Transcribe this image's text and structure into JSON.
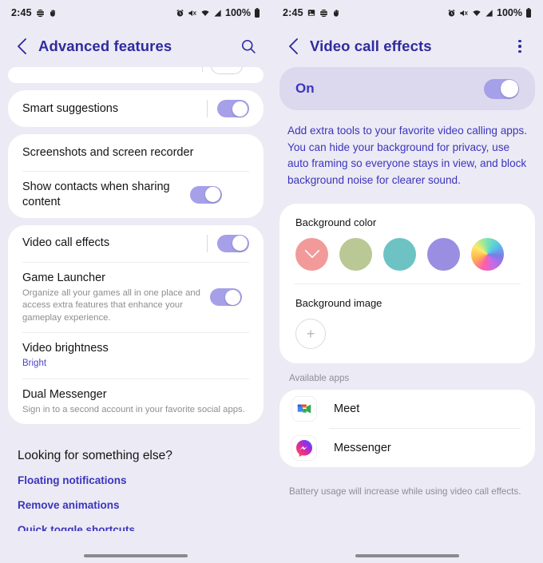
{
  "left": {
    "status": {
      "time": "2:45",
      "left_icons": [
        "globe-icon",
        "hand-icon"
      ],
      "right_icons": [
        "alarm-icon",
        "mute-icon",
        "wifi-icon",
        "signal-icon"
      ],
      "battery_text": "100%",
      "battery_icon": "battery-full-icon"
    },
    "appbar": {
      "title": "Advanced features",
      "back_icon": "back-chevron-icon",
      "search_icon": "search-icon"
    },
    "items": [
      {
        "title": "Smart suggestions",
        "toggle": true,
        "divider_before_toggle": true
      },
      {
        "title": "Screenshots and screen recorder"
      },
      {
        "title": "Show contacts when sharing content",
        "toggle": true
      },
      {
        "title": "Video call effects",
        "toggle": true,
        "divider_before_toggle": true
      },
      {
        "title": "Game Launcher",
        "sub": "Organize all your games all in one place and access extra features that enhance your gameplay experience.",
        "toggle": true
      },
      {
        "title": "Video brightness",
        "sub": "Bright",
        "sub_accent": true
      },
      {
        "title": "Dual Messenger",
        "sub": "Sign in to a second account in your favorite social apps."
      }
    ],
    "footer": {
      "title": "Looking for something else?",
      "links": [
        "Floating notifications",
        "Remove animations",
        "Quick toggle shortcuts"
      ]
    }
  },
  "right": {
    "status": {
      "time": "2:45",
      "left_icons": [
        "image-icon",
        "globe-icon",
        "hand-icon"
      ],
      "right_icons": [
        "alarm-icon",
        "mute-icon",
        "wifi-icon",
        "signal-icon"
      ],
      "battery_text": "100%",
      "battery_icon": "battery-full-icon"
    },
    "appbar": {
      "title": "Video call effects",
      "back_icon": "back-chevron-icon",
      "more_icon": "more-options-icon"
    },
    "master_switch": {
      "label": "On",
      "enabled": true
    },
    "description": "Add extra tools to your favorite video calling apps. You can hide your background for privacy, use auto framing so everyone stays in view, and block background noise for clearer sound.",
    "background_color": {
      "label": "Background color",
      "swatches": [
        {
          "name": "coral",
          "hex": "#f29a9a",
          "selected": true
        },
        {
          "name": "sage",
          "hex": "#b9c894",
          "selected": false
        },
        {
          "name": "teal",
          "hex": "#6dc3c4",
          "selected": false
        },
        {
          "name": "violet",
          "hex": "#9a8ee2",
          "selected": false
        },
        {
          "name": "rainbow",
          "hex": "rainbow",
          "selected": false
        }
      ]
    },
    "background_image": {
      "label": "Background image",
      "add_icon": "plus-icon"
    },
    "available_apps": {
      "label": "Available apps",
      "apps": [
        {
          "name": "Meet",
          "icon": "google-meet-icon"
        },
        {
          "name": "Messenger",
          "icon": "facebook-messenger-icon"
        }
      ]
    },
    "note": "Battery usage will increase while using video call effects."
  }
}
